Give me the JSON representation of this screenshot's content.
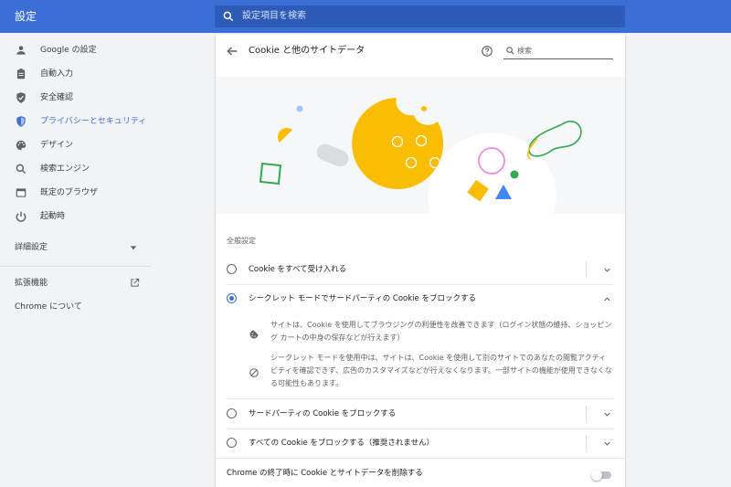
{
  "app": {
    "title": "設定"
  },
  "search": {
    "placeholder": "設定項目を検索"
  },
  "sidebar": {
    "items": [
      {
        "label": "Google の設定",
        "icon": "person-icon"
      },
      {
        "label": "自動入力",
        "icon": "clipboard-icon"
      },
      {
        "label": "安全確認",
        "icon": "shield-check-icon"
      },
      {
        "label": "プライバシーとセキュリティ",
        "icon": "shield-icon",
        "active": true
      },
      {
        "label": "デザイン",
        "icon": "palette-icon"
      },
      {
        "label": "検索エンジン",
        "icon": "search-icon"
      },
      {
        "label": "既定のブラウザ",
        "icon": "browser-icon"
      },
      {
        "label": "起動時",
        "icon": "power-icon"
      }
    ],
    "advanced": "詳細設定",
    "extensions": "拡張機能",
    "about": "Chrome について"
  },
  "page": {
    "title": "Cookie と他のサイトデータ",
    "search_placeholder": "検索"
  },
  "general": {
    "heading": "全般設定",
    "options": [
      {
        "label": "Cookie をすべて受け入れる",
        "checked": false
      },
      {
        "label": "シークレット モードでサードパーティの Cookie をブロックする",
        "checked": true
      },
      {
        "label": "サードパーティの Cookie をブロックする",
        "checked": false
      },
      {
        "label": "すべての Cookie をブロックする（推奨されません）",
        "checked": false
      }
    ],
    "expanded_desc": [
      "サイトは、Cookie を使用してブラウジングの利便性を改善できます（ログイン状態の維持、ショッピング カートの中身の保存などが行えます）",
      "シークレット モードを使用中は、サイトは、Cookie を使用して別のサイトでのあなたの閲覧アクティビティを確認できず、広告のカスタマイズなどが行えなくなります。一部サイトの機能が使用できなくなる可能性もあります。"
    ]
  },
  "clear_on_exit": {
    "label": "Chrome の終了時に Cookie とサイトデータを削除する",
    "enabled": false
  },
  "colors": {
    "accent": "#3b6fd6",
    "cookie": "#fbbc04",
    "green": "#34a853",
    "pink": "#ea8ae8"
  }
}
